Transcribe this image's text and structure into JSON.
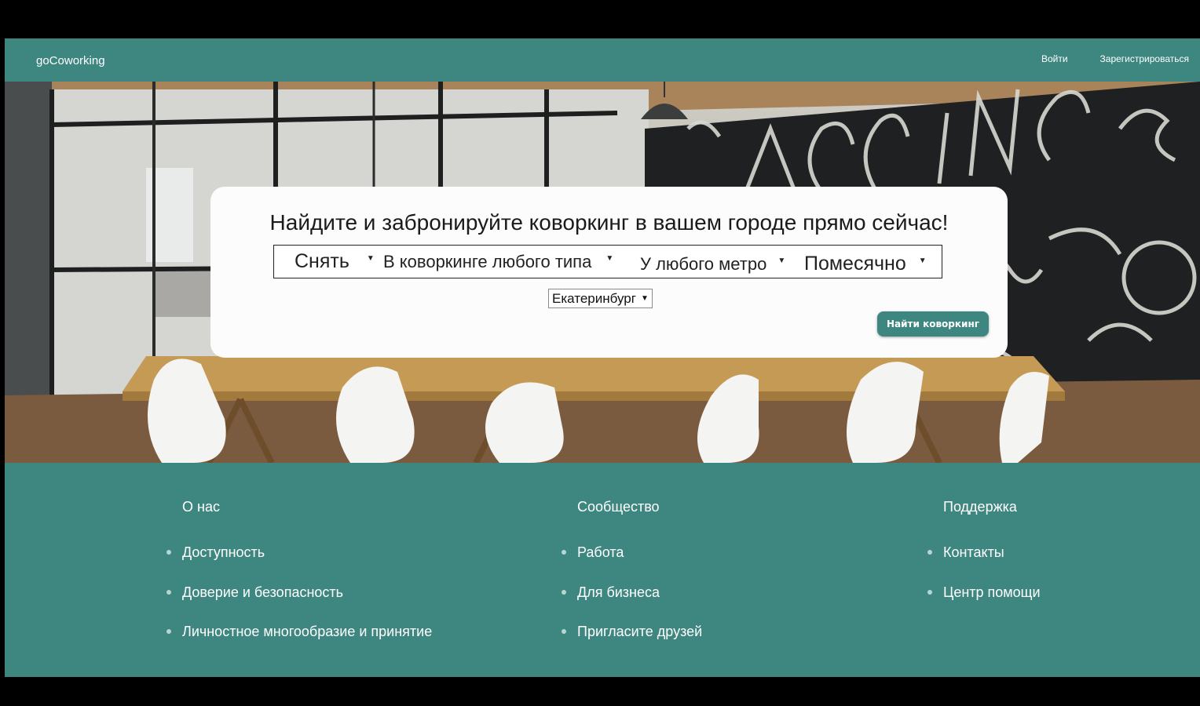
{
  "navbar": {
    "brand": "goCoworking",
    "login": "Войти",
    "register": "Зарегистрироваться"
  },
  "search": {
    "headline": "Найдите и забронируйте коворкинг в вашем городе прямо сейчас!",
    "filters": {
      "action": "Снять",
      "type": "В коворкинге любого типа",
      "metro": "У любого метро",
      "period": "Помесячно"
    },
    "city": "Екатеринбург",
    "caret": "▼",
    "button": "Найти коворкинг"
  },
  "footer": {
    "about": {
      "title": "О нас",
      "items": [
        "Доступность",
        "Доверие и безопасность",
        "Личностное многообразие и принятие"
      ]
    },
    "community": {
      "title": "Сообщество",
      "items": [
        "Работа",
        "Для бизнеса",
        "Пригласите друзей"
      ]
    },
    "support": {
      "title": "Поддержка",
      "items": [
        "Контакты",
        "Центр помощи"
      ]
    }
  },
  "colors": {
    "brand": "#3e8780",
    "card": "#fcfcfc",
    "background": "#000000"
  }
}
